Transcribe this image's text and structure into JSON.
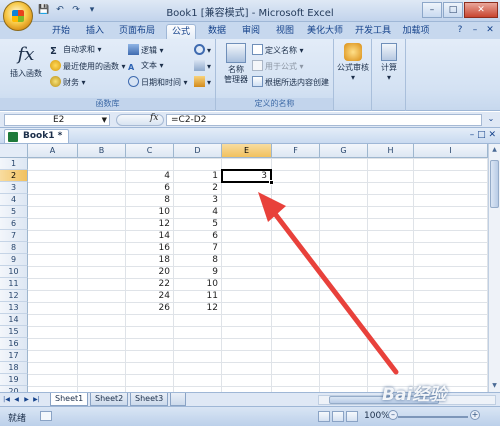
{
  "window": {
    "title": "Book1 [兼容模式] - Microsoft Excel",
    "min": "–",
    "max": "□",
    "close": "✕"
  },
  "qat": [
    "💾",
    "↶",
    "↷",
    "▾"
  ],
  "ribbon_tabs": [
    {
      "label": "开始",
      "active": false
    },
    {
      "label": "插入",
      "active": false
    },
    {
      "label": "页面布局",
      "active": false
    },
    {
      "label": "公式",
      "active": true
    },
    {
      "label": "数据",
      "active": false
    },
    {
      "label": "审阅",
      "active": false
    },
    {
      "label": "视图",
      "active": false
    },
    {
      "label": "美化大师",
      "active": false
    },
    {
      "label": "开发工具",
      "active": false
    },
    {
      "label": "加载项",
      "active": false
    }
  ],
  "ribbon_right": [
    "?",
    "–",
    "✕"
  ],
  "ribbon": {
    "function_library": {
      "label": "函数库",
      "insert_function": "插入函数",
      "autosum": "自动求和 ▾",
      "recent": "最近使用的函数 ▾",
      "financial": "财务 ▾",
      "logical": "逻辑 ▾",
      "text": "文本 ▾",
      "datetime": "日期和时间 ▾",
      "lookup": "▾",
      "math": "▾",
      "more": "▾"
    },
    "defined_names": {
      "label": "定义的名称",
      "name_manager_1": "名称",
      "name_manager_2": "管理器",
      "define_name": "定义名称 ▾",
      "use_in_formula": "用于公式 ▾",
      "create_from_selection": "根据所选内容创建"
    },
    "auditing": {
      "label": "公式审核",
      "sub": "▾"
    },
    "calculation": {
      "label": "计算",
      "sub": "▾"
    }
  },
  "formula_bar": {
    "name_box": "E2",
    "fx": "fx",
    "formula": "=C2-D2"
  },
  "workbook": {
    "tab": "Book1 *",
    "controls": "–  □  ✕"
  },
  "columns": [
    "A",
    "B",
    "C",
    "D",
    "E",
    "F",
    "G",
    "H",
    "I"
  ],
  "rows": [
    "1",
    "2",
    "3",
    "4",
    "5",
    "6",
    "7",
    "8",
    "9",
    "10",
    "11",
    "12",
    "13",
    "14",
    "15",
    "16",
    "17",
    "18",
    "19",
    "20"
  ],
  "cells": {
    "C": [
      "",
      "4",
      "6",
      "8",
      "10",
      "12",
      "14",
      "16",
      "18",
      "20",
      "22",
      "24",
      "26"
    ],
    "D": [
      "",
      "1",
      "2",
      "3",
      "4",
      "5",
      "6",
      "7",
      "8",
      "9",
      "10",
      "11",
      "12"
    ],
    "E2": "3"
  },
  "selected": {
    "column": "E",
    "row": "2"
  },
  "sheets": [
    {
      "label": "Sheet1",
      "active": true
    },
    {
      "label": "Sheet2",
      "active": false
    },
    {
      "label": "Sheet3",
      "active": false
    }
  ],
  "sheet_nav": [
    "|◀",
    "◀",
    "▶",
    "▶|"
  ],
  "status": {
    "ready": "就绪",
    "zoom": "100%",
    "zoom_minus": "–",
    "zoom_plus": "+"
  },
  "colors": {
    "accent": "#15428b",
    "selection": "#f1c15f",
    "arrow": "#e8413b"
  },
  "watermark": "Bai经验"
}
